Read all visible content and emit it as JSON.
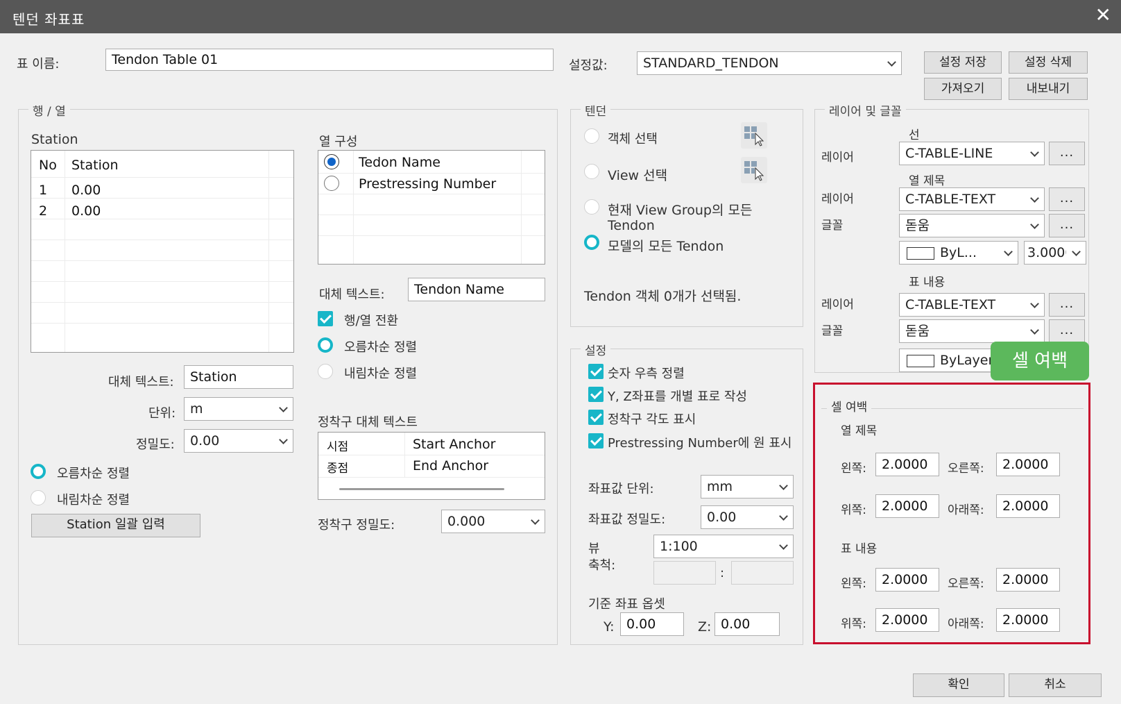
{
  "window": {
    "title": "텐던 좌표표",
    "close": "✕"
  },
  "top": {
    "table_name_label": "표 이름:",
    "table_name_value": "Tendon Table 01",
    "preset_label": "설정값:",
    "preset_value": "STANDARD_TENDON",
    "save_btn": "설정 저장",
    "delete_btn": "설정 삭제",
    "import_btn": "가져오기",
    "export_btn": "내보내기"
  },
  "rowcol": {
    "group_title": "행 / 열",
    "station_label": "Station",
    "station_table": {
      "headers": [
        "No",
        "Station"
      ],
      "rows": [
        [
          "1",
          "0.00"
        ],
        [
          "2",
          "0.00"
        ]
      ]
    },
    "alt_text_label": "대체 텍스트:",
    "alt_text_value": "Station",
    "unit_label": "단위:",
    "unit_value": "m",
    "precision_label": "정밀도:",
    "precision_value": "0.00",
    "asc_label": "오름차순 정렬",
    "desc_label": "내림차순 정렬",
    "bulk_btn": "Station 일괄 입력"
  },
  "columns": {
    "title": "열 구성",
    "items": [
      "Tedon Name",
      "Prestressing Number"
    ],
    "alt_text_label": "대체 텍스트:",
    "alt_text_value": "Tendon Name",
    "transpose_label": "행/열 전환",
    "asc_label": "오름차순 정렬",
    "desc_label": "내림차순 정렬",
    "anchor_title": "정착구 대체 텍스트",
    "anchor_rows": [
      [
        "시점",
        "Start Anchor"
      ],
      [
        "종점",
        "End Anchor"
      ]
    ],
    "anchor_precision_label": "정착구 정밀도:",
    "anchor_precision_value": "0.000"
  },
  "tendon": {
    "group_title": "텐던",
    "opt_object": "객체 선택",
    "opt_view": "View 선택",
    "opt_group_line1": "현재 View Group의 모든",
    "opt_group_line2": "Tendon",
    "opt_model": "모델의 모든 Tendon",
    "status": "Tendon 객체 0개가 선택됨."
  },
  "settings": {
    "group_title": "설정",
    "chk1": "숫자 우측 정렬",
    "chk2": "Y, Z좌표를 개별 표로 작성",
    "chk3": "정착구 각도 표시",
    "chk4": "Prestressing Number에 원 표시",
    "coord_unit_label": "좌표값 단위:",
    "coord_unit_value": "mm",
    "coord_prec_label": "좌표값 정밀도:",
    "coord_prec_value": "0.00",
    "view_label1": "뷰",
    "view_label2": "축척:",
    "view_scale_value": "1:100",
    "colon": ":",
    "offset_label": "기준 좌표 옵셋",
    "y_label": "Y:",
    "y_value": "0.00",
    "z_label": "Z:",
    "z_value": "0.00"
  },
  "layer": {
    "group_title": "레이어 및 글꼴",
    "line_title": "선",
    "layer_label": "레이어",
    "font_label": "글꼴",
    "line_layer": "C-TABLE-LINE",
    "col_title": "열 제목",
    "col_layer": "C-TABLE-TEXT",
    "col_font": "돋움",
    "col_color": "ByL...",
    "col_size": "3.0000",
    "body_title": "표 내용",
    "body_layer": "C-TABLE-TEXT",
    "body_font": "돋움",
    "body_color": "ByLayer",
    "dots": "..."
  },
  "margin": {
    "callout": "셀 여백",
    "group_title": "셀 여백",
    "col_title": "열 제목",
    "body_title": "표 내용",
    "left_label": "왼쪽:",
    "right_label": "오른쪽:",
    "top_label": "위쪽:",
    "bottom_label": "아래쪽:",
    "col_left": "2.0000",
    "col_right": "2.0000",
    "col_top": "2.0000",
    "col_bottom": "2.0000",
    "body_left": "2.0000",
    "body_right": "2.0000",
    "body_top": "2.0000",
    "body_bottom": "2.0000"
  },
  "footer": {
    "ok": "확인",
    "cancel": "취소"
  },
  "colors": {
    "accent": "#16b6c8",
    "callout": "#5cb85c",
    "highlight": "#c8102e"
  }
}
